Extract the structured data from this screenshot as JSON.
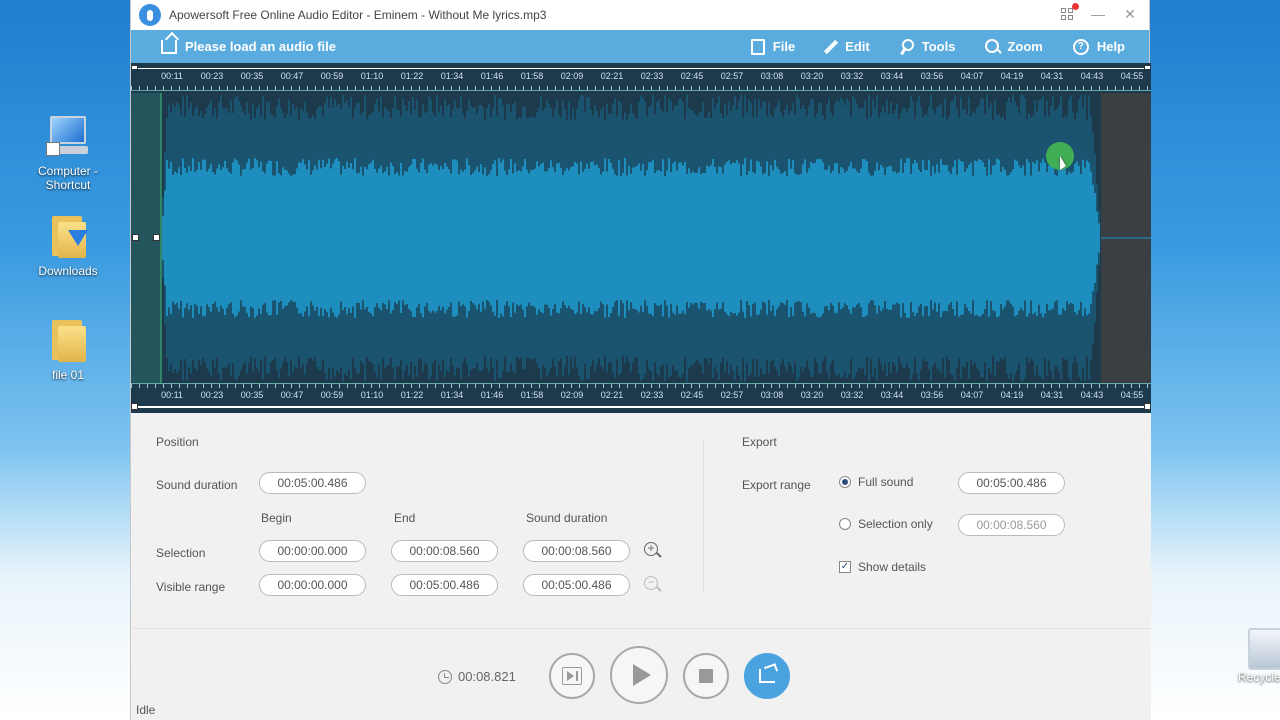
{
  "desktop": {
    "icons": [
      {
        "label": "Computer - Shortcut"
      },
      {
        "label": "Downloads"
      },
      {
        "label": "file 01"
      }
    ],
    "recycle_label": "Recycle"
  },
  "window": {
    "title": "Apowersoft Free Online Audio Editor - Eminem - Without Me lyrics.mp3",
    "controls": {
      "minimize": "—",
      "close": "✕"
    }
  },
  "menubar": {
    "load_label": "Please load an audio file",
    "items": [
      {
        "label": "File",
        "icon": "file-icon"
      },
      {
        "label": "Edit",
        "icon": "edit-icon"
      },
      {
        "label": "Tools",
        "icon": "tools-icon"
      },
      {
        "label": "Zoom",
        "icon": "zoom-icon"
      },
      {
        "label": "Help",
        "icon": "help-icon"
      }
    ]
  },
  "timeline": {
    "ticks": [
      "00:11",
      "00:23",
      "00:35",
      "00:47",
      "00:59",
      "01:10",
      "01:22",
      "01:34",
      "01:46",
      "01:58",
      "02:09",
      "02:21",
      "02:33",
      "02:45",
      "02:57",
      "03:08",
      "03:20",
      "03:32",
      "03:44",
      "03:56",
      "04:07",
      "04:19",
      "04:31",
      "04:43",
      "04:55"
    ]
  },
  "waveform": {
    "colors": {
      "background": "#1d3a4d",
      "loud": "#1e96c8",
      "quiet": "#1a5a78",
      "selection": "#2a6a6a",
      "end_region": "#3a3f44"
    }
  },
  "position": {
    "title": "Position",
    "sound_duration_label": "Sound duration",
    "sound_duration_value": "00:05:00.486",
    "col_begin": "Begin",
    "col_end": "End",
    "col_duration": "Sound duration",
    "selection_label": "Selection",
    "selection_begin": "00:00:00.000",
    "selection_end": "00:00:08.560",
    "selection_duration": "00:00:08.560",
    "visible_label": "Visible range",
    "visible_begin": "00:00:00.000",
    "visible_end": "00:05:00.486",
    "visible_duration": "00:05:00.486"
  },
  "export": {
    "title": "Export",
    "range_label": "Export range",
    "full_sound_label": "Full sound",
    "full_sound_value": "00:05:00.486",
    "selection_only_label": "Selection only",
    "selection_only_value": "00:00:08.560",
    "show_details_label": "Show details",
    "show_details_checked": true
  },
  "transport": {
    "time": "00:08.821",
    "status": "Idle"
  }
}
